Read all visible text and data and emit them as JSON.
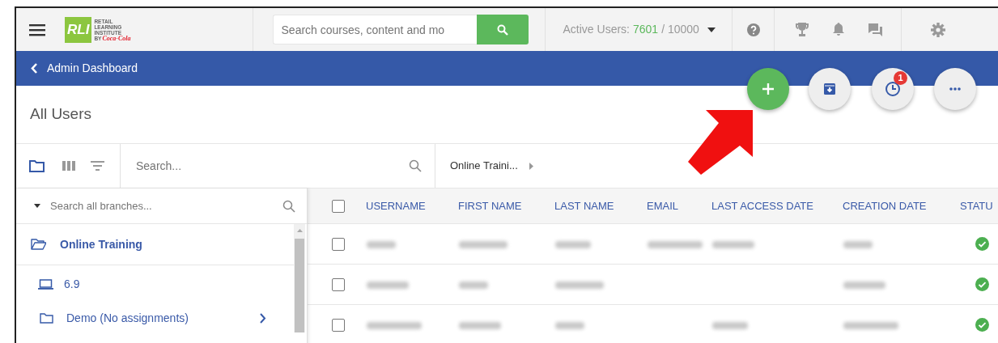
{
  "header": {
    "logo": {
      "mark": "RLI",
      "lines": [
        "RETAIL",
        "LEARNING",
        "INSTITUTE"
      ],
      "by": "BY",
      "brand": "Coca-Cola"
    },
    "search": {
      "placeholder": "Search courses, content and mo"
    },
    "active_users": {
      "label": "Active Users:",
      "count": "7601",
      "limit": "/ 10000"
    }
  },
  "nav_bar": {
    "back_label": "Admin Dashboard"
  },
  "page_title": "All Users",
  "toolbar": {
    "search": {
      "placeholder": "Search..."
    },
    "breadcrumb": "Online Traini..."
  },
  "branches": {
    "search": {
      "placeholder": "Search all branches..."
    },
    "items": [
      {
        "kind": "root",
        "label": "Online Training"
      },
      {
        "kind": "device",
        "label": "6.9"
      },
      {
        "kind": "folder",
        "label": "Demo (No assignments)",
        "expandable": true
      }
    ]
  },
  "table": {
    "all_checked": false,
    "columns": [
      "USERNAME",
      "FIRST NAME",
      "LAST NAME",
      "EMAIL",
      "LAST ACCESS DATE",
      "CREATION DATE",
      "STATU"
    ],
    "rows": [
      {
        "checked": false,
        "cells": [
          {
            "blurred": true
          },
          {
            "blurred": true
          },
          {
            "blurred": true
          },
          {
            "blurred": true
          },
          {
            "blurred": true
          },
          {
            "blurred": true
          }
        ],
        "active": true
      },
      {
        "checked": false,
        "cells": [
          {
            "blurred": true
          },
          {
            "blurred": true
          },
          {
            "blurred": true
          },
          {
            "blurred": false
          },
          {
            "blurred": false
          },
          {
            "blurred": true
          }
        ],
        "active": true
      },
      {
        "checked": false,
        "cells": [
          {
            "blurred": true
          },
          {
            "blurred": true
          },
          {
            "blurred": true
          },
          {
            "blurred": false
          },
          {
            "blurred": true
          },
          {
            "blurred": true
          }
        ],
        "active": true
      }
    ]
  },
  "actions": {
    "notification_count": "1"
  }
}
